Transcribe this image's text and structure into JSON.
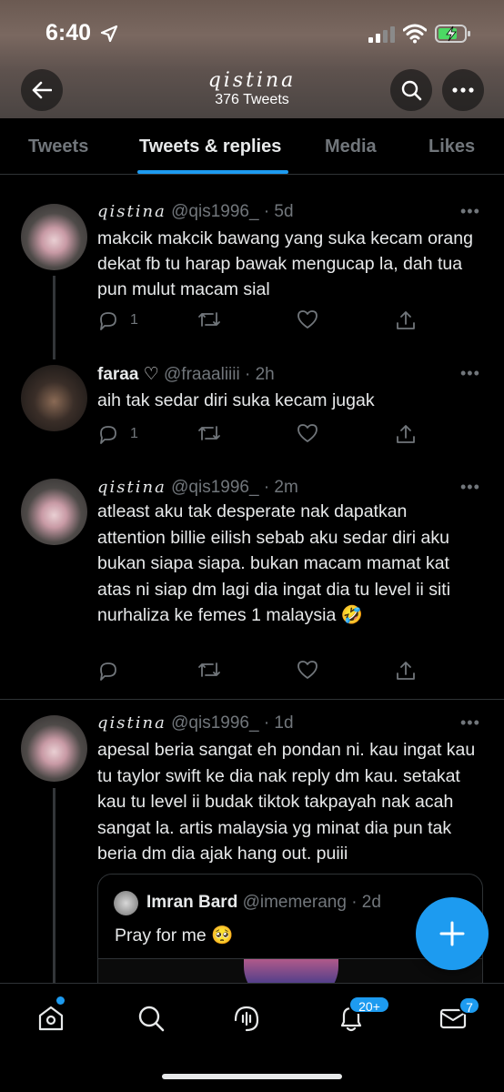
{
  "status": {
    "time": "6:40"
  },
  "profile": {
    "name": "qistina",
    "tweet_count": "376 Tweets"
  },
  "tabs": [
    {
      "label": "Tweets"
    },
    {
      "label": "Tweets & replies"
    },
    {
      "label": "Media"
    },
    {
      "label": "Likes"
    }
  ],
  "tweets": [
    {
      "name": "qistina",
      "handle_time": "@qis1996_ · 5d",
      "text": "makcik makcik bawang yang suka kecam orang dekat fb tu harap bawak mengucap la, dah tua pun mulut macam sial",
      "replies": "1"
    },
    {
      "name": "faraa ♡",
      "handle_time": "@fraaaliiii · 2h",
      "text": "aih tak sedar diri suka kecam jugak",
      "replies": "1"
    },
    {
      "name": "qistina",
      "handle_time": "@qis1996_ · 2m",
      "text": "atleast aku tak desperate nak dapatkan attention billie eilish sebab aku sedar diri aku bukan siapa siapa. bukan macam mamat kat atas ni siap dm lagi dia ingat dia tu level ii siti nurhaliza ke femes 1 malaysia 🤣"
    },
    {
      "name": "qistina",
      "handle_time": "@qis1996_ · 1d",
      "text": "apesal beria sangat eh pondan ni. kau ingat kau tu taylor swift ke dia nak reply dm kau. setakat kau tu level ii budak tiktok takpayah nak acah sangat la. artis malaysia yg minat dia pun tak beria dm dia ajak hang out. puiii"
    }
  ],
  "quote": {
    "name": "Imran Bard",
    "handle_time": "@imemerang · 2d",
    "text": "Pray for me 🥺"
  },
  "more_label": "•••",
  "nav": {
    "notifications_badge": "20+",
    "messages_badge": "7"
  },
  "colors": {
    "accent": "#1d9bf0",
    "muted": "#71767b",
    "text": "#e7e9ea"
  }
}
